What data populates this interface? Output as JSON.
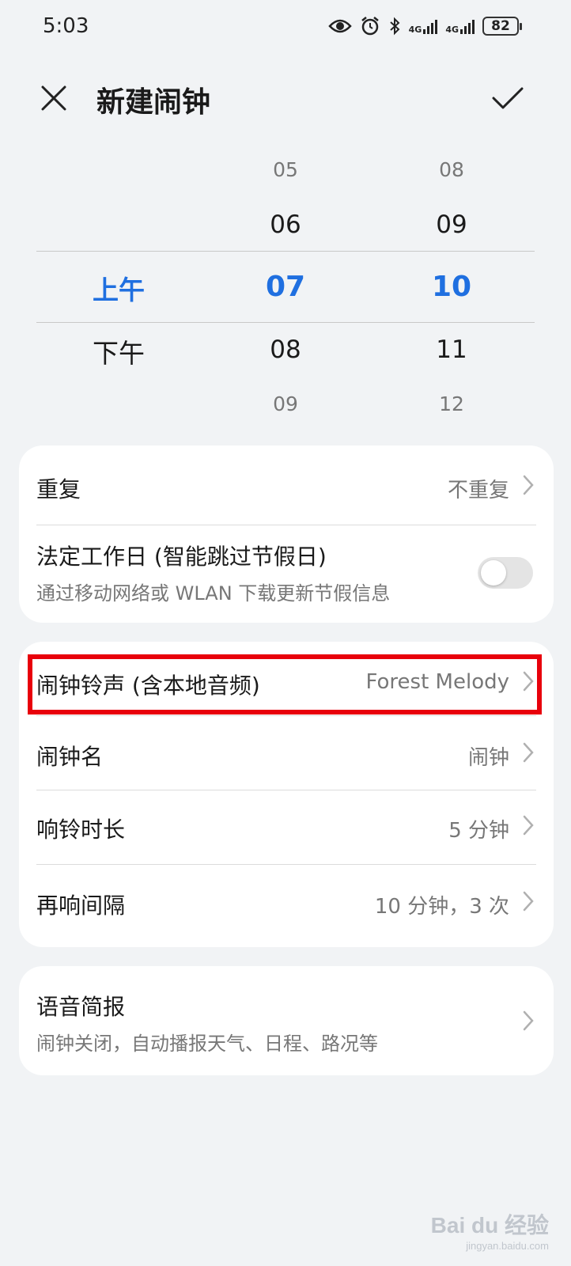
{
  "status_bar": {
    "time": "5:03",
    "net1": "4G",
    "net2": "4G",
    "battery": "82"
  },
  "header": {
    "title": "新建闹钟",
    "close_icon": "close-icon",
    "confirm_icon": "check-icon"
  },
  "picker": {
    "ampm": [
      "上午",
      "下午"
    ],
    "hours": [
      "05",
      "06",
      "07",
      "08",
      "09"
    ],
    "minutes": [
      "08",
      "09",
      "10",
      "11",
      "12"
    ],
    "selected_color": "#1f6fe0"
  },
  "card1": {
    "repeat": {
      "label": "重复",
      "value": "不重复"
    },
    "workday": {
      "label": "法定工作日 (智能跳过节假日)",
      "sub": "通过移动网络或 WLAN 下载更新节假信息",
      "enabled": false
    }
  },
  "card2": {
    "ringtone": {
      "label": "闹钟铃声 (含本地音频)",
      "value": "Forest Melody"
    },
    "name": {
      "label": "闹钟名",
      "value": "闹钟"
    },
    "duration": {
      "label": "响铃时长",
      "value": "5 分钟"
    },
    "snooze": {
      "label": "再响间隔",
      "value": "10 分钟，3 次"
    }
  },
  "card3": {
    "briefing": {
      "label": "语音简报",
      "sub": "闹钟关闭，自动播报天气、日程、路况等"
    }
  },
  "annotation_color": "#e8000b",
  "watermark": {
    "logo": "Bai du 经验",
    "sub": "jingyan.baidu.com"
  }
}
